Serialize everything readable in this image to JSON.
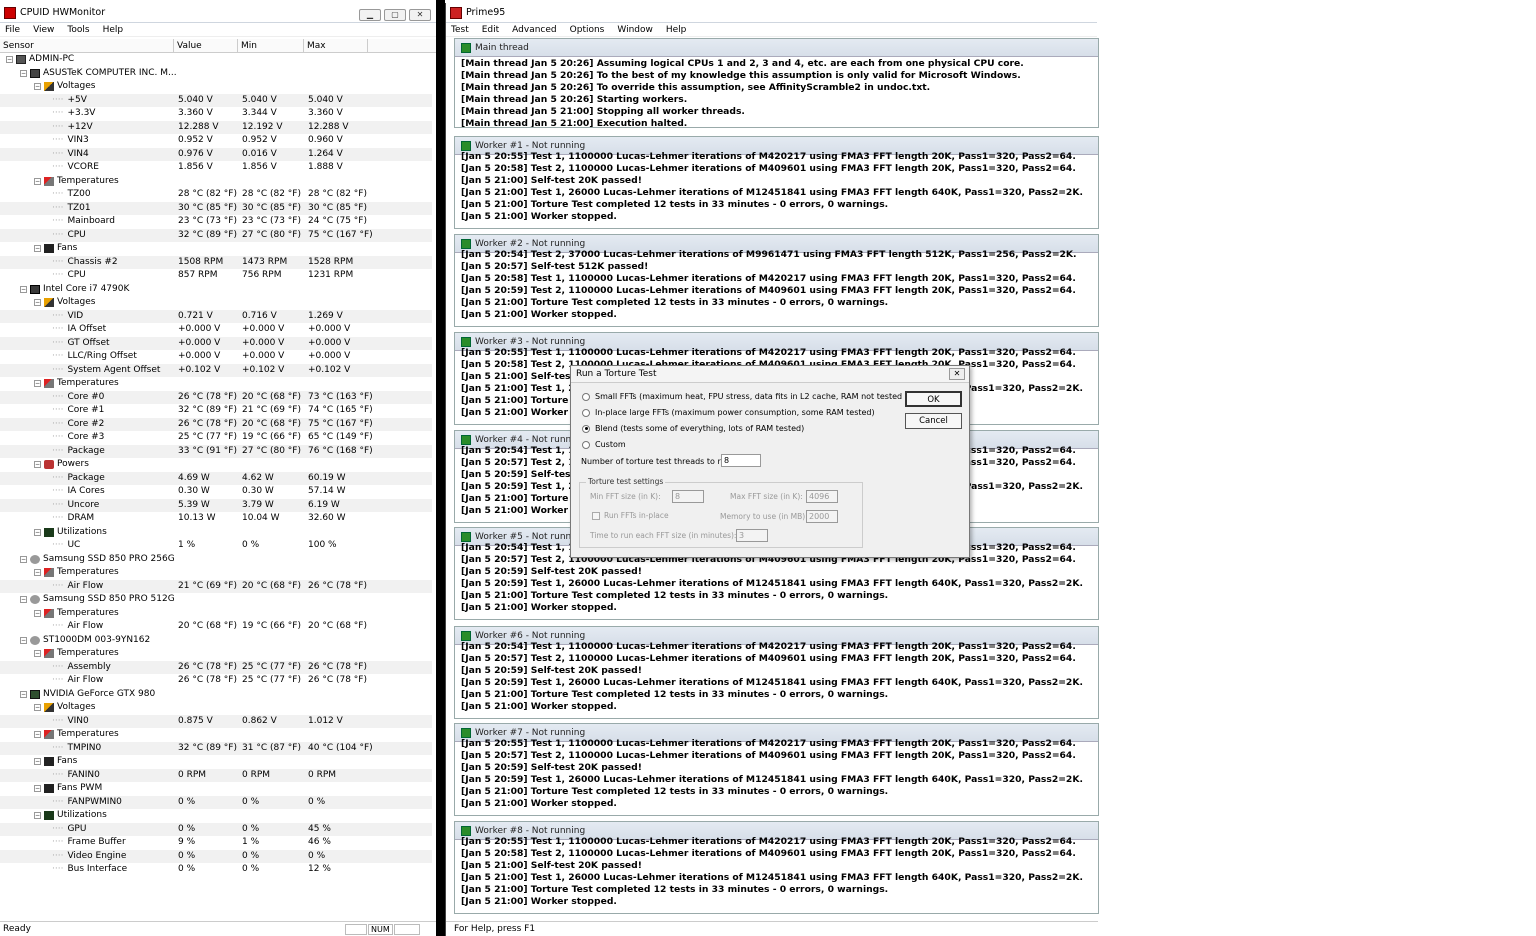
{
  "hw": {
    "title": "CPUID HWMonitor",
    "menu": [
      "File",
      "View",
      "Tools",
      "Help"
    ],
    "columns": [
      "Sensor",
      "Value",
      "Min",
      "Max"
    ],
    "status": "Ready",
    "status_num": "NUM",
    "rows": [
      {
        "d": 0,
        "t": "pc",
        "n": "ADMIN-PC",
        "v": "",
        "mn": "",
        "mx": ""
      },
      {
        "d": 1,
        "t": "board",
        "n": "ASUSTeK COMPUTER INC. M...",
        "v": "",
        "mn": "",
        "mx": ""
      },
      {
        "d": 2,
        "t": "volt",
        "n": "Voltages",
        "v": "",
        "mn": "",
        "mx": ""
      },
      {
        "d": 3,
        "t": "leaf",
        "n": "+5V",
        "v": "5.040 V",
        "mn": "5.040 V",
        "mx": "5.040 V"
      },
      {
        "d": 3,
        "t": "leaf",
        "n": "+3.3V",
        "v": "3.360 V",
        "mn": "3.344 V",
        "mx": "3.360 V"
      },
      {
        "d": 3,
        "t": "leaf",
        "n": "+12V",
        "v": "12.288 V",
        "mn": "12.192 V",
        "mx": "12.288 V"
      },
      {
        "d": 3,
        "t": "leaf",
        "n": "VIN3",
        "v": "0.952 V",
        "mn": "0.952 V",
        "mx": "0.960 V"
      },
      {
        "d": 3,
        "t": "leaf",
        "n": "VIN4",
        "v": "0.976 V",
        "mn": "0.016 V",
        "mx": "1.264 V"
      },
      {
        "d": 3,
        "t": "leaf",
        "n": "VCORE",
        "v": "1.856 V",
        "mn": "1.856 V",
        "mx": "1.888 V"
      },
      {
        "d": 2,
        "t": "temp",
        "n": "Temperatures",
        "v": "",
        "mn": "",
        "mx": ""
      },
      {
        "d": 3,
        "t": "leaf",
        "n": "TZ00",
        "v": "28 °C  (82 °F)",
        "mn": "28 °C  (82 °F)",
        "mx": "28 °C  (82 °F)"
      },
      {
        "d": 3,
        "t": "leaf",
        "n": "TZ01",
        "v": "30 °C  (85 °F)",
        "mn": "30 °C  (85 °F)",
        "mx": "30 °C  (85 °F)"
      },
      {
        "d": 3,
        "t": "leaf",
        "n": "Mainboard",
        "v": "23 °C  (73 °F)",
        "mn": "23 °C  (73 °F)",
        "mx": "24 °C  (75 °F)"
      },
      {
        "d": 3,
        "t": "leaf",
        "n": "CPU",
        "v": "32 °C  (89 °F)",
        "mn": "27 °C  (80 °F)",
        "mx": "75 °C  (167 °F)"
      },
      {
        "d": 2,
        "t": "fan",
        "n": "Fans",
        "v": "",
        "mn": "",
        "mx": ""
      },
      {
        "d": 3,
        "t": "leaf",
        "n": "Chassis #2",
        "v": "1508 RPM",
        "mn": "1473 RPM",
        "mx": "1528 RPM"
      },
      {
        "d": 3,
        "t": "leaf",
        "n": "CPU",
        "v": "857 RPM",
        "mn": "756 RPM",
        "mx": "1231 RPM"
      },
      {
        "d": 1,
        "t": "chip",
        "n": "Intel Core i7 4790K",
        "v": "",
        "mn": "",
        "mx": ""
      },
      {
        "d": 2,
        "t": "volt",
        "n": "Voltages",
        "v": "",
        "mn": "",
        "mx": ""
      },
      {
        "d": 3,
        "t": "leaf",
        "n": "VID",
        "v": "0.721 V",
        "mn": "0.716 V",
        "mx": "1.269 V"
      },
      {
        "d": 3,
        "t": "leaf",
        "n": "IA Offset",
        "v": "+0.000 V",
        "mn": "+0.000 V",
        "mx": "+0.000 V"
      },
      {
        "d": 3,
        "t": "leaf",
        "n": "GT Offset",
        "v": "+0.000 V",
        "mn": "+0.000 V",
        "mx": "+0.000 V"
      },
      {
        "d": 3,
        "t": "leaf",
        "n": "LLC/Ring Offset",
        "v": "+0.000 V",
        "mn": "+0.000 V",
        "mx": "+0.000 V"
      },
      {
        "d": 3,
        "t": "leaf",
        "n": "System Agent Offset",
        "v": "+0.102 V",
        "mn": "+0.102 V",
        "mx": "+0.102 V"
      },
      {
        "d": 2,
        "t": "temp",
        "n": "Temperatures",
        "v": "",
        "mn": "",
        "mx": ""
      },
      {
        "d": 3,
        "t": "leaf",
        "n": "Core #0",
        "v": "26 °C  (78 °F)",
        "mn": "20 °C  (68 °F)",
        "mx": "73 °C  (163 °F)"
      },
      {
        "d": 3,
        "t": "leaf",
        "n": "Core #1",
        "v": "32 °C  (89 °F)",
        "mn": "21 °C  (69 °F)",
        "mx": "74 °C  (165 °F)"
      },
      {
        "d": 3,
        "t": "leaf",
        "n": "Core #2",
        "v": "26 °C  (78 °F)",
        "mn": "20 °C  (68 °F)",
        "mx": "75 °C  (167 °F)"
      },
      {
        "d": 3,
        "t": "leaf",
        "n": "Core #3",
        "v": "25 °C  (77 °F)",
        "mn": "19 °C  (66 °F)",
        "mx": "65 °C  (149 °F)"
      },
      {
        "d": 3,
        "t": "leaf",
        "n": "Package",
        "v": "33 °C  (91 °F)",
        "mn": "27 °C  (80 °F)",
        "mx": "76 °C  (168 °F)"
      },
      {
        "d": 2,
        "t": "power",
        "n": "Powers",
        "v": "",
        "mn": "",
        "mx": ""
      },
      {
        "d": 3,
        "t": "leaf",
        "n": "Package",
        "v": "4.69 W",
        "mn": "4.62 W",
        "mx": "60.19 W"
      },
      {
        "d": 3,
        "t": "leaf",
        "n": "IA Cores",
        "v": "0.30 W",
        "mn": "0.30 W",
        "mx": "57.14 W"
      },
      {
        "d": 3,
        "t": "leaf",
        "n": "Uncore",
        "v": "5.39 W",
        "mn": "3.79 W",
        "mx": "6.19 W"
      },
      {
        "d": 3,
        "t": "leaf",
        "n": "DRAM",
        "v": "10.13 W",
        "mn": "10.04 W",
        "mx": "32.60 W"
      },
      {
        "d": 2,
        "t": "util",
        "n": "Utilizations",
        "v": "",
        "mn": "",
        "mx": ""
      },
      {
        "d": 3,
        "t": "leaf",
        "n": "UC",
        "v": "1 %",
        "mn": "0 %",
        "mx": "100 %"
      },
      {
        "d": 1,
        "t": "disk",
        "n": "Samsung SSD 850 PRO 256G",
        "v": "",
        "mn": "",
        "mx": ""
      },
      {
        "d": 2,
        "t": "temp",
        "n": "Temperatures",
        "v": "",
        "mn": "",
        "mx": ""
      },
      {
        "d": 3,
        "t": "leaf",
        "n": "Air Flow",
        "v": "21 °C  (69 °F)",
        "mn": "20 °C  (68 °F)",
        "mx": "26 °C  (78 °F)"
      },
      {
        "d": 1,
        "t": "disk",
        "n": "Samsung SSD 850 PRO 512G",
        "v": "",
        "mn": "",
        "mx": ""
      },
      {
        "d": 2,
        "t": "temp",
        "n": "Temperatures",
        "v": "",
        "mn": "",
        "mx": ""
      },
      {
        "d": 3,
        "t": "leaf",
        "n": "Air Flow",
        "v": "20 °C  (68 °F)",
        "mn": "19 °C  (66 °F)",
        "mx": "20 °C  (68 °F)"
      },
      {
        "d": 1,
        "t": "disk",
        "n": "ST1000DM 003-9YN162",
        "v": "",
        "mn": "",
        "mx": ""
      },
      {
        "d": 2,
        "t": "temp",
        "n": "Temperatures",
        "v": "",
        "mn": "",
        "mx": ""
      },
      {
        "d": 3,
        "t": "leaf",
        "n": "Assembly",
        "v": "26 °C  (78 °F)",
        "mn": "25 °C  (77 °F)",
        "mx": "26 °C  (78 °F)"
      },
      {
        "d": 3,
        "t": "leaf",
        "n": "Air Flow",
        "v": "26 °C  (78 °F)",
        "mn": "25 °C  (77 °F)",
        "mx": "26 °C  (78 °F)"
      },
      {
        "d": 1,
        "t": "gpu",
        "n": "NVIDIA GeForce GTX 980",
        "v": "",
        "mn": "",
        "mx": ""
      },
      {
        "d": 2,
        "t": "volt",
        "n": "Voltages",
        "v": "",
        "mn": "",
        "mx": ""
      },
      {
        "d": 3,
        "t": "leaf",
        "n": "VIN0",
        "v": "0.875 V",
        "mn": "0.862 V",
        "mx": "1.012 V"
      },
      {
        "d": 2,
        "t": "temp",
        "n": "Temperatures",
        "v": "",
        "mn": "",
        "mx": ""
      },
      {
        "d": 3,
        "t": "leaf",
        "n": "TMPIN0",
        "v": "32 °C  (89 °F)",
        "mn": "31 °C  (87 °F)",
        "mx": "40 °C  (104 °F)"
      },
      {
        "d": 2,
        "t": "fan",
        "n": "Fans",
        "v": "",
        "mn": "",
        "mx": ""
      },
      {
        "d": 3,
        "t": "leaf",
        "n": "FANIN0",
        "v": "0 RPM",
        "mn": "0 RPM",
        "mx": "0 RPM"
      },
      {
        "d": 2,
        "t": "fan",
        "n": "Fans PWM",
        "v": "",
        "mn": "",
        "mx": ""
      },
      {
        "d": 3,
        "t": "leaf",
        "n": "FANPWMIN0",
        "v": "0 %",
        "mn": "0 %",
        "mx": "0 %"
      },
      {
        "d": 2,
        "t": "util",
        "n": "Utilizations",
        "v": "",
        "mn": "",
        "mx": ""
      },
      {
        "d": 3,
        "t": "leaf",
        "n": "GPU",
        "v": "0 %",
        "mn": "0 %",
        "mx": "45 %"
      },
      {
        "d": 3,
        "t": "leaf",
        "n": "Frame Buffer",
        "v": "9 %",
        "mn": "1 %",
        "mx": "46 %"
      },
      {
        "d": 3,
        "t": "leaf",
        "n": "Video Engine",
        "v": "0 %",
        "mn": "0 %",
        "mx": "0 %"
      },
      {
        "d": 3,
        "t": "leaf",
        "n": "Bus Interface",
        "v": "0 %",
        "mn": "0 %",
        "mx": "12 %"
      }
    ]
  },
  "p95": {
    "title": "Prime95",
    "menu": [
      "Test",
      "Edit",
      "Advanced",
      "Options",
      "Window",
      "Help"
    ],
    "status": "For Help, press F1",
    "windows": [
      {
        "title": "Main thread",
        "lines": [
          "[Main thread Jan 5 20:26] Assuming logical CPUs 1 and 2, 3 and 4, etc. are each from one physical CPU core.",
          "[Main thread Jan 5 20:26] To the best of my knowledge this assumption is only valid for Microsoft Windows.",
          "[Main thread Jan 5 20:26] To override this assumption, see AffinityScramble2 in undoc.txt.",
          "[Main thread Jan 5 20:26] Starting workers.",
          "[Main thread Jan 5 21:00] Stopping all worker threads.",
          "[Main thread Jan 5 21:00] Execution halted."
        ]
      },
      {
        "title": "Worker #1 - Not running",
        "lines": [
          "[Jan 5 20:55] Test 1, 1100000 Lucas-Lehmer iterations of M420217 using FMA3 FFT length 20K, Pass1=320, Pass2=64.",
          "[Jan 5 20:58] Test 2, 1100000 Lucas-Lehmer iterations of M409601 using FMA3 FFT length 20K, Pass1=320, Pass2=64.",
          "[Jan 5 21:00] Self-test 20K passed!",
          "[Jan 5 21:00] Test 1, 26000 Lucas-Lehmer iterations of M12451841 using FMA3 FFT length 640K, Pass1=320, Pass2=2K.",
          "[Jan 5 21:00] Torture Test completed 12 tests in 33 minutes - 0 errors, 0 warnings.",
          "[Jan 5 21:00] Worker stopped."
        ]
      },
      {
        "title": "Worker #2 - Not running",
        "lines": [
          "[Jan 5 20:54] Test 2, 37000 Lucas-Lehmer iterations of M9961471 using FMA3 FFT length 512K, Pass1=256, Pass2=2K.",
          "[Jan 5 20:57] Self-test 512K passed!",
          "[Jan 5 20:58] Test 1, 1100000 Lucas-Lehmer iterations of M420217 using FMA3 FFT length 20K, Pass1=320, Pass2=64.",
          "[Jan 5 20:59] Test 2, 1100000 Lucas-Lehmer iterations of M409601 using FMA3 FFT length 20K, Pass1=320, Pass2=64.",
          "[Jan 5 21:00] Torture Test completed 12 tests in 33 minutes - 0 errors, 0 warnings.",
          "[Jan 5 21:00] Worker stopped."
        ]
      },
      {
        "title": "Worker #3 - Not running",
        "lines": [
          "[Jan 5 20:55] Test 1, 1100000 Lucas-Lehmer iterations of M420217 using FMA3 FFT length 20K, Pass1=320, Pass2=64.",
          "[Jan 5 20:58] Test 2, 1100000 Lucas-Lehmer iterations of M409601 using FMA3 FFT length 20K, Pass1=320, Pass2=64.",
          "[Jan 5 21:00] Self-test 20K passed!",
          "[Jan 5 21:00] Test 1, 26000 Lucas-Lehmer iterations of M12451841 using FMA3 FFT length 640K, Pass1=320, Pass2=2K.",
          "[Jan 5 21:00] Torture Test completed 12 tests in 33 minutes - 0 errors, 0 warnings.",
          "[Jan 5 21:00] Worker stopped."
        ]
      },
      {
        "title": "Worker #4 - Not running",
        "lines": [
          "[Jan 5 20:54] Test 1, 1100000 Lucas-Lehmer iterations of M420217 using FMA3 FFT length 20K, Pass1=320, Pass2=64.",
          "[Jan 5 20:57] Test 2, 1100000 Lucas-Lehmer iterations of M409601 using FMA3 FFT length 20K, Pass1=320, Pass2=64.",
          "[Jan 5 20:59] Self-test 20K passed!",
          "[Jan 5 20:59] Test 1, 26000 Lucas-Lehmer iterations of M12451841 using FMA3 FFT length 640K, Pass1=320, Pass2=2K.",
          "[Jan 5 21:00] Torture Test completed 12 tests in 33 minutes - 0 errors, 0 warnings.",
          "[Jan 5 21:00] Worker stopped."
        ]
      },
      {
        "title": "Worker #5 - Not running",
        "lines": [
          "[Jan 5 20:54] Test 1, 1100000 Lucas-Lehmer iterations of M420217 using FMA3 FFT length 20K, Pass1=320, Pass2=64.",
          "[Jan 5 20:57] Test 2, 1100000 Lucas-Lehmer iterations of M409601 using FMA3 FFT length 20K, Pass1=320, Pass2=64.",
          "[Jan 5 20:59] Self-test 20K passed!",
          "[Jan 5 20:59] Test 1, 26000 Lucas-Lehmer iterations of M12451841 using FMA3 FFT length 640K, Pass1=320, Pass2=2K.",
          "[Jan 5 21:00] Torture Test completed 12 tests in 33 minutes - 0 errors, 0 warnings.",
          "[Jan 5 21:00] Worker stopped."
        ]
      },
      {
        "title": "Worker #6 - Not running",
        "lines": [
          "[Jan 5 20:54] Test 1, 1100000 Lucas-Lehmer iterations of M420217 using FMA3 FFT length 20K, Pass1=320, Pass2=64.",
          "[Jan 5 20:57] Test 2, 1100000 Lucas-Lehmer iterations of M409601 using FMA3 FFT length 20K, Pass1=320, Pass2=64.",
          "[Jan 5 20:59] Self-test 20K passed!",
          "[Jan 5 20:59] Test 1, 26000 Lucas-Lehmer iterations of M12451841 using FMA3 FFT length 640K, Pass1=320, Pass2=2K.",
          "[Jan 5 21:00] Torture Test completed 12 tests in 33 minutes - 0 errors, 0 warnings.",
          "[Jan 5 21:00] Worker stopped."
        ]
      },
      {
        "title": "Worker #7 - Not running",
        "lines": [
          "[Jan 5 20:55] Test 1, 1100000 Lucas-Lehmer iterations of M420217 using FMA3 FFT length 20K, Pass1=320, Pass2=64.",
          "[Jan 5 20:57] Test 2, 1100000 Lucas-Lehmer iterations of M409601 using FMA3 FFT length 20K, Pass1=320, Pass2=64.",
          "[Jan 5 20:59] Self-test 20K passed!",
          "[Jan 5 20:59] Test 1, 26000 Lucas-Lehmer iterations of M12451841 using FMA3 FFT length 640K, Pass1=320, Pass2=2K.",
          "[Jan 5 21:00] Torture Test completed 12 tests in 33 minutes - 0 errors, 0 warnings.",
          "[Jan 5 21:00] Worker stopped."
        ]
      },
      {
        "title": "Worker #8 - Not running",
        "lines": [
          "[Jan 5 20:55] Test 1, 1100000 Lucas-Lehmer iterations of M420217 using FMA3 FFT length 20K, Pass1=320, Pass2=64.",
          "[Jan 5 20:58] Test 2, 1100000 Lucas-Lehmer iterations of M409601 using FMA3 FFT length 20K, Pass1=320, Pass2=64.",
          "[Jan 5 21:00] Self-test 20K passed!",
          "[Jan 5 21:00] Test 1, 26000 Lucas-Lehmer iterations of M12451841 using FMA3 FFT length 640K, Pass1=320, Pass2=2K.",
          "[Jan 5 21:00] Torture Test completed 12 tests in 33 minutes - 0 errors, 0 warnings.",
          "[Jan 5 21:00] Worker stopped."
        ]
      }
    ]
  },
  "dialog": {
    "title": "Run a Torture Test",
    "options": [
      "Small FFTs (maximum heat, FPU stress, data fits in L2 cache, RAM not tested much)",
      "In-place large FFTs (maximum power consumption, some RAM tested)",
      "Blend (tests some of everything, lots of RAM tested)",
      "Custom"
    ],
    "selected": 2,
    "threads_label": "Number of torture test threads to run:",
    "threads_value": "8",
    "group_label": "Torture test settings",
    "min_fft_label": "Min FFT size (in K):",
    "min_fft_value": "8",
    "max_fft_label": "Max FFT size (in K):",
    "max_fft_value": "4096",
    "inplace_label": "Run FFTs in-place",
    "memory_label": "Memory to use (in MB):",
    "memory_value": "2000",
    "time_label": "Time to run each FFT size (in minutes):",
    "time_value": "3",
    "ok": "OK",
    "cancel": "Cancel"
  }
}
